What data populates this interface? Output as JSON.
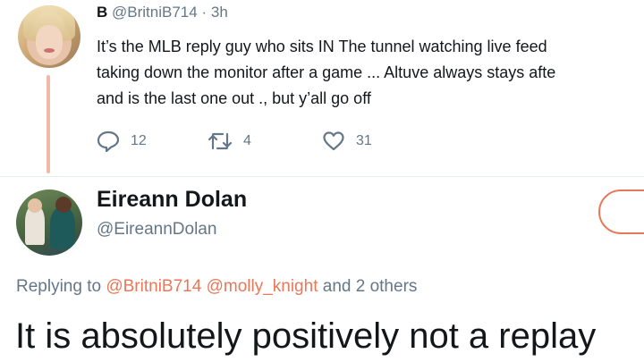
{
  "parent_tweet": {
    "author_name": "B",
    "author_handle": "@BritniB714",
    "separator": "·",
    "timestamp": "3h",
    "text_lines": [
      "It’s the MLB reply guy who sits IN The tunnel watching live feed",
      "taking down the monitor after a game ... Altuve always stays afte",
      "and is the last one out ., but y’all go off"
    ],
    "actions": {
      "reply_count": "12",
      "retweet_count": "4",
      "like_count": "31"
    }
  },
  "reply_tweet": {
    "author_name": "Eireann Dolan",
    "author_handle": "@EireannDolan",
    "replying_to": {
      "prefix": "Replying to",
      "mention_1": "@BritniB714",
      "mention_2": "@molly_knight",
      "suffix": "and 2 others"
    },
    "text": "It is absolutely positively not a replay"
  },
  "colors": {
    "accent": "#e8785a",
    "secondary_text": "#657786",
    "primary_text": "#14171a",
    "thread_line": "#f0b9a8"
  },
  "icons": {
    "reply": "reply-icon",
    "retweet": "retweet-icon",
    "like": "heart-icon"
  }
}
